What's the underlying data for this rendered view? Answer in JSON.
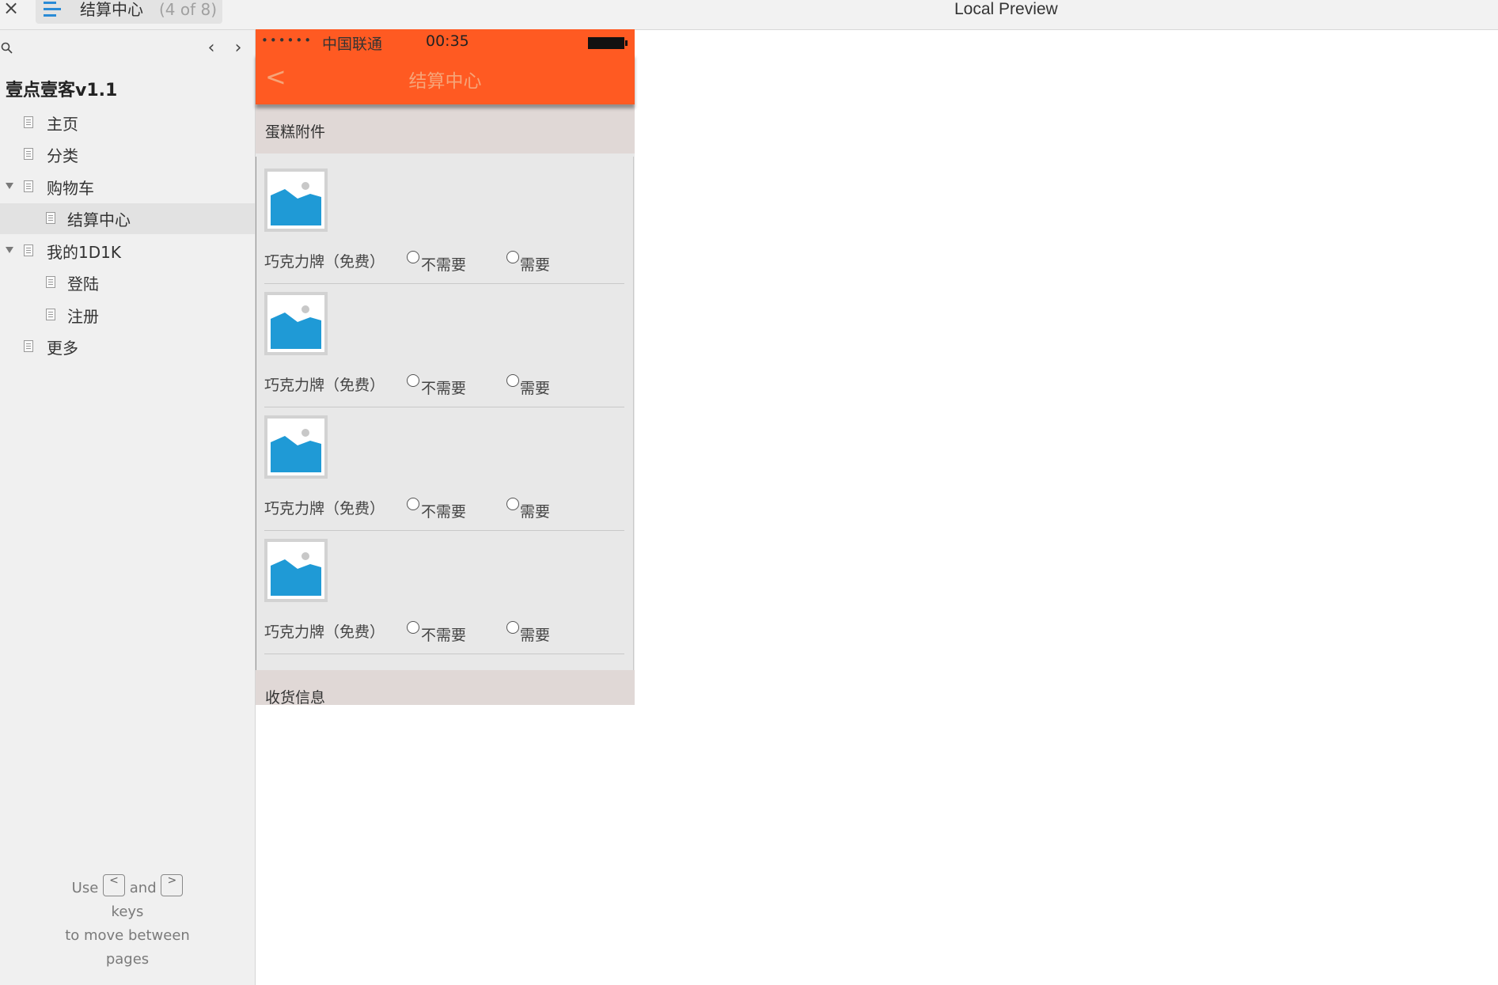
{
  "topbar": {
    "close": "×",
    "page_title": "结算中心",
    "page_count": "(4 of 8)",
    "preview_title": "Local Preview"
  },
  "sidebar": {
    "prev": "‹",
    "next": "›",
    "project": "壹点壹客v1.1",
    "items": [
      {
        "label": "主页",
        "level": 0,
        "expanded": null
      },
      {
        "label": "分类",
        "level": 0,
        "expanded": null
      },
      {
        "label": "购物车",
        "level": 0,
        "expanded": true
      },
      {
        "label": "结算中心",
        "level": 1,
        "expanded": null,
        "active": true
      },
      {
        "label": "我的1D1K",
        "level": 0,
        "expanded": true
      },
      {
        "label": "登陆",
        "level": 1,
        "expanded": null
      },
      {
        "label": "注册",
        "level": 1,
        "expanded": null
      },
      {
        "label": "更多",
        "level": 0,
        "expanded": null
      }
    ],
    "help": {
      "use": "Use",
      "and": "and",
      "key_prev": "<",
      "key_next": ">",
      "keys": "keys",
      "line2": "to move between",
      "line3": "pages"
    }
  },
  "phone": {
    "signal": "••••••",
    "carrier": "中国联通",
    "time": "00:35",
    "back": "<",
    "title": "结算中心",
    "section1": "蛋糕附件",
    "items": [
      {
        "label": "巧克力牌（免费）",
        "opt1": "不需要",
        "opt2": "需要"
      },
      {
        "label": "巧克力牌（免费）",
        "opt1": "不需要",
        "opt2": "需要"
      },
      {
        "label": "巧克力牌（免费）",
        "opt1": "不需要",
        "opt2": "需要"
      },
      {
        "label": "巧克力牌（免费）",
        "opt1": "不需要",
        "opt2": "需要"
      }
    ],
    "section2": "收货信息"
  },
  "colors": {
    "accent": "#ff5a22",
    "nav_text": "#f6a478",
    "image_blue": "#1f9ad6"
  }
}
